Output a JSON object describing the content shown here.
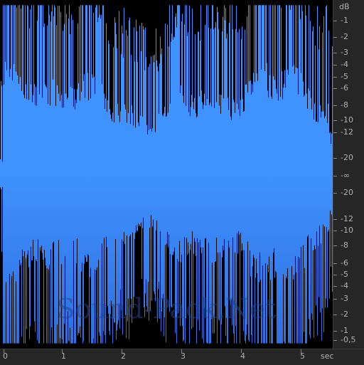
{
  "colors": {
    "waveform_top": "#3f92ff",
    "waveform_bottom": "#2f6fe0",
    "background": "#000000",
    "ruler_bg": "#262626",
    "ruler_text": "#b0b0b0"
  },
  "watermark": {
    "text": "Sound-Pack.Net"
  },
  "db_ruler": {
    "unit": "dB",
    "top_labels": [
      "-1",
      "-2",
      "-3",
      "-4",
      "-5",
      "-6",
      "-8",
      "-10",
      "-12",
      "-20"
    ],
    "center_label": "-∞",
    "bottom_labels": [
      "-20",
      "-12",
      "-10",
      "-8",
      "-6",
      "-5",
      "-4",
      "-3",
      "-2",
      "-1",
      "-0,5"
    ]
  },
  "time_ruler": {
    "unit": "sec",
    "labels": [
      "0",
      "1",
      "2",
      "3",
      "4",
      "5"
    ]
  }
}
